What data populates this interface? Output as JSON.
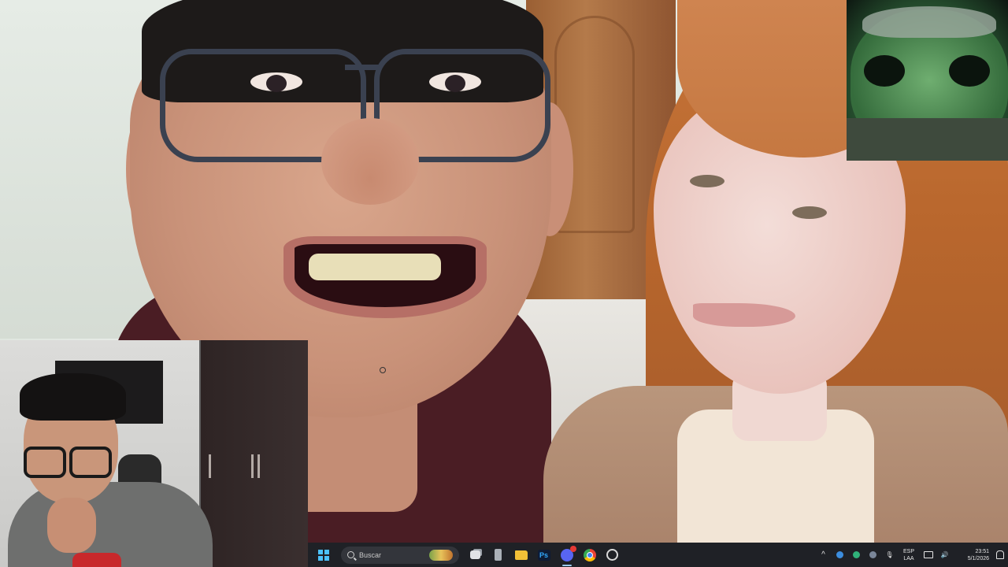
{
  "taskbar": {
    "search_placeholder": "Buscar",
    "apps": [
      {
        "name": "task-view",
        "icon": "task-view-icon"
      },
      {
        "name": "device",
        "icon": "device-icon"
      },
      {
        "name": "file-explorer",
        "icon": "folder-icon"
      },
      {
        "name": "photoshop",
        "icon": "photoshop-icon",
        "label": "Ps"
      },
      {
        "name": "discord",
        "icon": "discord-icon",
        "active": true
      },
      {
        "name": "chrome",
        "icon": "chrome-icon"
      },
      {
        "name": "obs",
        "icon": "obs-icon"
      }
    ],
    "tray": {
      "chevron": "^",
      "mic": "🎙",
      "speaker": "🔊",
      "lang_top": "ESP",
      "lang_bottom": "LAA",
      "time": "23:51",
      "date": "5/1/2026"
    },
    "accent_color": "#4cc2ff"
  }
}
